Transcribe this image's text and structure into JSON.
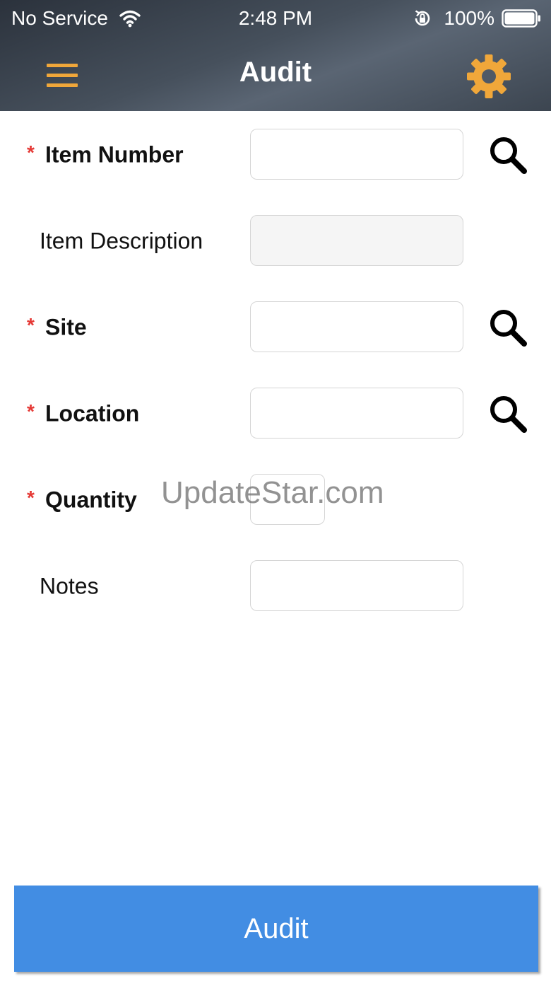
{
  "status_bar": {
    "carrier": "No Service",
    "time": "2:48 PM",
    "battery_percent": "100%",
    "icons": [
      "wifi-icon",
      "rotation-lock-icon",
      "battery-icon"
    ]
  },
  "nav": {
    "title": "Audit",
    "left_icon": "hamburger-menu-icon",
    "right_icon": "gear-icon",
    "accent_color": "#f0a73a"
  },
  "form": {
    "required_marker": "*",
    "fields": [
      {
        "label": "Item Number",
        "required": true,
        "value": "",
        "placeholder": "",
        "has_search": true,
        "disabled": false
      },
      {
        "label": "Item Description",
        "required": false,
        "value": "",
        "placeholder": "",
        "has_search": false,
        "disabled": true
      },
      {
        "label": "Site",
        "required": true,
        "value": "",
        "placeholder": "",
        "has_search": true,
        "disabled": false
      },
      {
        "label": "Location",
        "required": true,
        "value": "",
        "placeholder": "",
        "has_search": true,
        "disabled": false
      },
      {
        "label": "Quantity",
        "required": true,
        "value": "",
        "placeholder": "",
        "has_search": false,
        "disabled": false
      },
      {
        "label": "Notes",
        "required": false,
        "value": "",
        "placeholder": "",
        "has_search": false,
        "disabled": false
      }
    ]
  },
  "watermark": "UpdateStar.com",
  "footer": {
    "audit_button_label": "Audit",
    "button_color": "#428de3"
  }
}
